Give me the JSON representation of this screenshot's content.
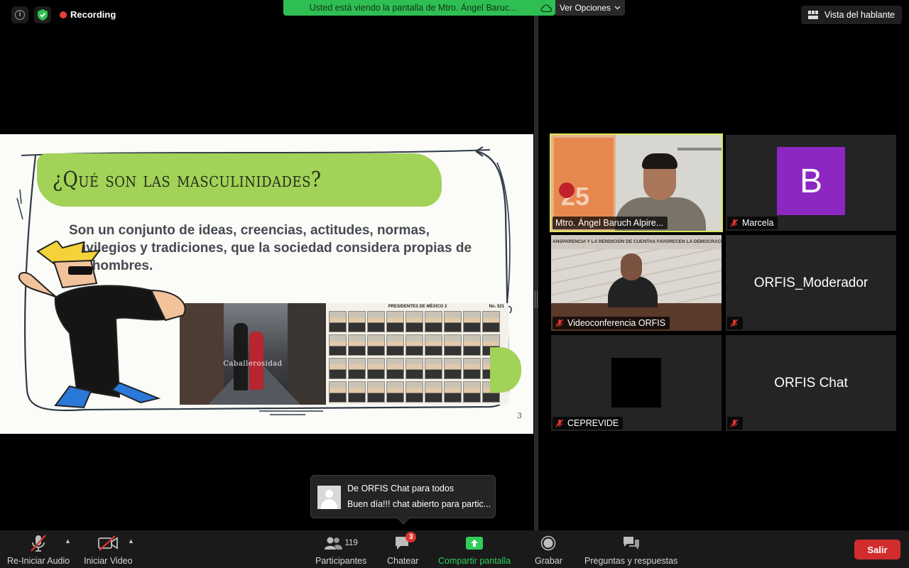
{
  "top_bar": {
    "recording_label": "Recording",
    "share_banner": "Usted está viendo la pantalla de Mtro. Ángel Baruc...",
    "view_options": "Ver Opciones",
    "speaker_view": "Vista del hablante"
  },
  "slide": {
    "title": "¿Qué son las masculinidades?",
    "body": "Son un conjunto de ideas, creencias, actitudes, normas, privilegios y tradiciones, que la sociedad considera propias de los hombres.",
    "photo_caption": "Caballerosidad",
    "presidents_header": "PRESIDENTES DE MÉXICO 2",
    "presidents_no": "No. 521",
    "page_number": "3"
  },
  "gallery": {
    "tiles": [
      {
        "name": "Mtro. Ángel Baruch Alpire...",
        "type": "video",
        "active": true,
        "muted": false
      },
      {
        "name": "Marcela",
        "type": "avatar",
        "avatar_letter": "B",
        "muted": true
      },
      {
        "name": "Videoconferencia ORFIS",
        "type": "video",
        "muted": true,
        "banner_text": "ANSPARENCIA Y LA RENDICIÓN DE CUENTAS FAVORECEN LA DEMOCRACIA"
      },
      {
        "name": "ORFIS_Moderador",
        "type": "name_only",
        "muted": true
      },
      {
        "name": "CEPREVIDE",
        "type": "video_off",
        "muted": true
      },
      {
        "name": "ORFIS Chat",
        "type": "name_only",
        "muted": true
      }
    ]
  },
  "chat_toast": {
    "from": "De ORFIS Chat para todos",
    "message": "Buen día!!! chat abierto para partic..."
  },
  "toolbar": {
    "audio_label": "Re-Iniciar Audio",
    "video_label": "Iniciar Video",
    "participants_label": "Participantes",
    "participants_count": "119",
    "chat_label": "Chatear",
    "chat_badge": "3",
    "share_label": "Compartir pantalla",
    "record_label": "Grabar",
    "qa_label": "Preguntas y respuestas",
    "leave_label": "Salir"
  },
  "colors": {
    "share_green": "#2fbe52",
    "leave_red": "#d12d2d",
    "recording_red": "#e8403a",
    "active_speaker": "#d8e85a",
    "slide_accent": "#a2d258",
    "avatar_purple": "#8d27c2"
  }
}
